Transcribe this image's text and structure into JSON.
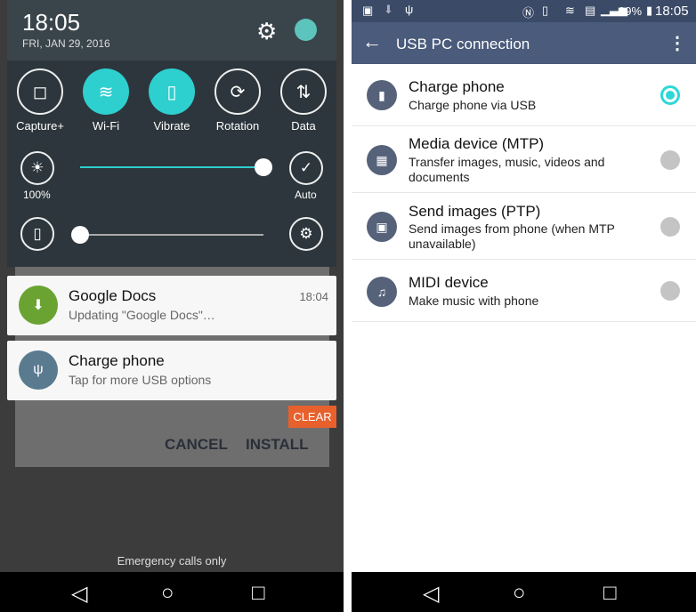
{
  "left": {
    "clock": "18:05",
    "date": "FRI, JAN 29, 2016",
    "tiles": [
      {
        "label": "Capture+",
        "on": false
      },
      {
        "label": "Wi-Fi",
        "on": true
      },
      {
        "label": "Vibrate",
        "on": true
      },
      {
        "label": "Rotation",
        "on": false
      },
      {
        "label": "Data",
        "on": false
      }
    ],
    "brightness": {
      "label": "100%",
      "value": 100,
      "auto_label": "Auto"
    },
    "volume": {
      "value": 0
    },
    "notifications": [
      {
        "title": "Google Docs",
        "subtitle": "Updating \"Google Docs\"…",
        "time": "18:04",
        "color": "#6aa332"
      },
      {
        "title": "Charge phone",
        "subtitle": "Tap for more USB options",
        "color": "#5a7a8f"
      }
    ],
    "clear_label": "CLEAR",
    "dialog": {
      "cancel": "CANCEL",
      "install": "INSTALL"
    },
    "emergency": "Emergency calls only"
  },
  "right": {
    "status": {
      "battery": "99%",
      "time": "18:05"
    },
    "title": "USB PC connection",
    "options": [
      {
        "title": "Charge phone",
        "subtitle": "Charge phone via USB",
        "selected": true
      },
      {
        "title": "Media device (MTP)",
        "subtitle": "Transfer images, music, videos and documents",
        "selected": false
      },
      {
        "title": "Send images (PTP)",
        "subtitle": "Send images from phone (when MTP unavailable)",
        "selected": false
      },
      {
        "title": "MIDI device",
        "subtitle": "Make music with phone",
        "selected": false
      }
    ]
  },
  "colors": {
    "accent": "#2ecfcf",
    "clear": "#e8602c"
  }
}
